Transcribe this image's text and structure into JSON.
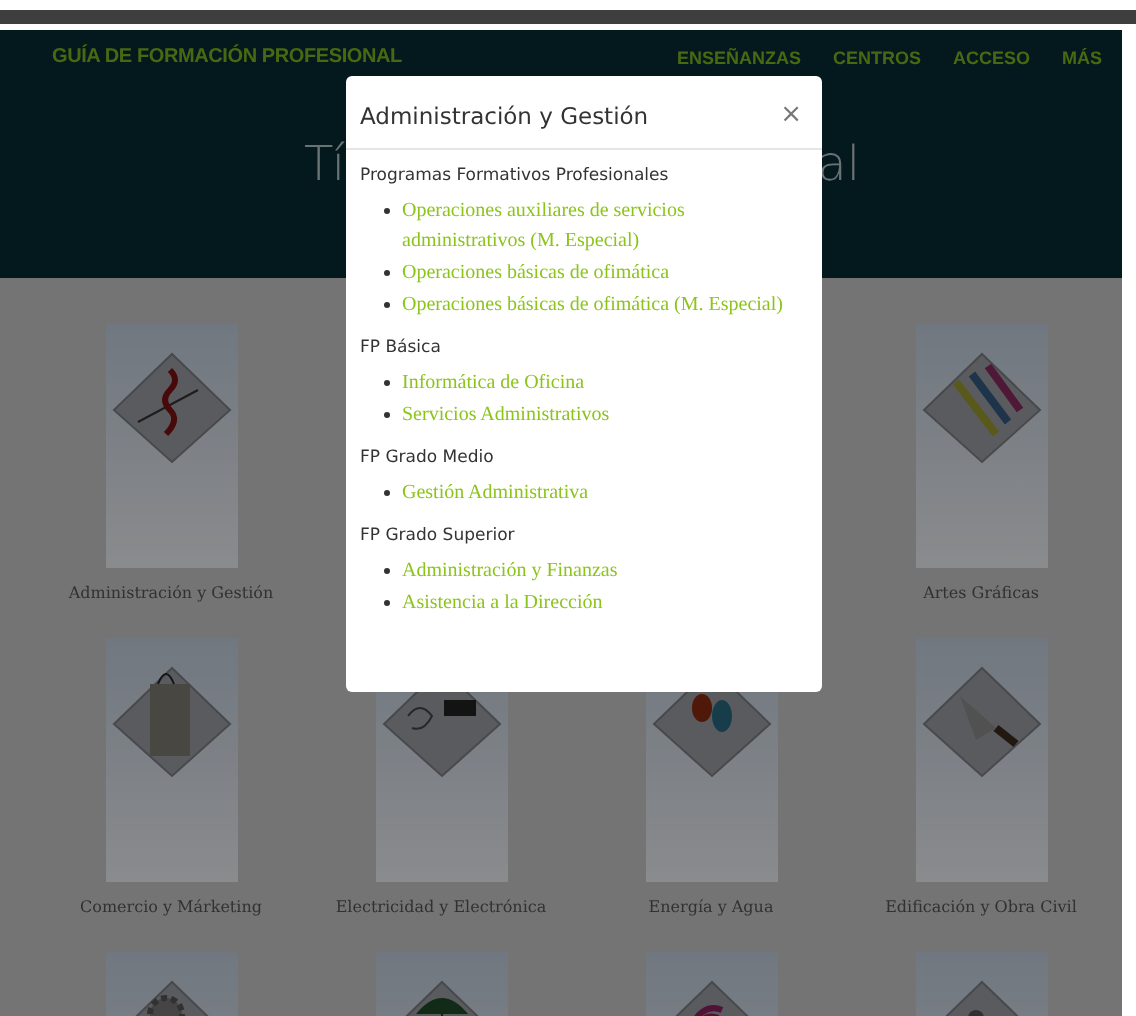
{
  "header": {
    "logo": "GUÍA DE FORMACIÓN PROFESIONAL",
    "nav": [
      "ENSEÑANZAS",
      "CENTROS",
      "ACCESO",
      "MÁS"
    ],
    "hero_title_visible": [
      "Tí",
      "al"
    ]
  },
  "categories": [
    {
      "kind": "chart",
      "label": "Administración y Gestión"
    },
    {
      "kind": "covered"
    },
    {
      "kind": "covered"
    },
    {
      "kind": "pencils",
      "label": "Artes Gráficas"
    },
    {
      "kind": "bag",
      "label": "Comercio y Márketing"
    },
    {
      "kind": "plug",
      "label": "Electricidad y Electrónica"
    },
    {
      "kind": "drops",
      "label": "Energía y Agua"
    },
    {
      "kind": "trowel",
      "label": "Edificación y Obra Civil"
    },
    {
      "kind": "gear"
    },
    {
      "kind": "umbrella"
    },
    {
      "kind": "signal"
    },
    {
      "kind": "tools"
    }
  ],
  "modal": {
    "title": "Administración y Gestión",
    "close": "×",
    "sections": [
      {
        "heading": "Programas Formativos Profesionales",
        "links": [
          "Operaciones auxiliares de servicios administrativos (M. Especial)",
          "Operaciones básicas de ofimática",
          "Operaciones básicas de ofimática (M. Especial)"
        ]
      },
      {
        "heading": "FP Básica",
        "links": [
          "Informática de Oficina",
          "Servicios Administrativos"
        ]
      },
      {
        "heading": "FP Grado Medio",
        "links": [
          "Gestión Administrativa"
        ]
      },
      {
        "heading": "FP Grado Superior",
        "links": [
          "Administración y Finanzas",
          "Asistencia a la Dirección"
        ]
      }
    ]
  }
}
